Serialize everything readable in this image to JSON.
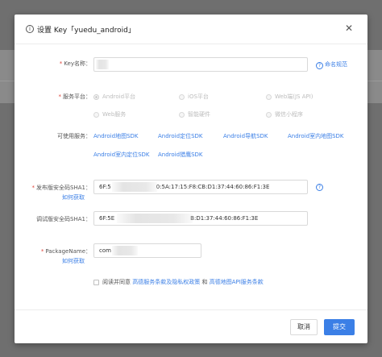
{
  "dialog": {
    "title": "设置 Key「yuedu_android」",
    "close_icon": "close-icon",
    "info_icon": "info-circle-icon"
  },
  "form": {
    "key_name": {
      "label": "Key名称：",
      "value": "",
      "help_link": "命名规范"
    },
    "platform": {
      "label": "服务平台：",
      "options": [
        "Android平台",
        "iOS平台",
        "Web端(JS API)",
        "Web服务",
        "智能硬件",
        "微信小程序"
      ],
      "selected": "Android平台"
    },
    "sdk": {
      "label": "可使用服务：",
      "items": [
        "Android地图SDK",
        "Android定位SDK",
        "Android导航SDK",
        "Android室内地图SDK",
        "Android室内定位SDK",
        "Android猎鹰SDK"
      ]
    },
    "release_sha1": {
      "label": "发布版安全码SHA1：",
      "how": "如何获取",
      "value_start": "6F:5",
      "value_end": "0:5A:17:15:F8:CB:D1:37:44:60:86:F1:3E"
    },
    "debug_sha1": {
      "label": "调试版安全码SHA1：",
      "value_start": "6F:5E",
      "value_end": "B:D1:37:44:60:86:F1:3E"
    },
    "package": {
      "label": "PackageName：",
      "how": "如何获取",
      "value": "com"
    },
    "agreement": {
      "prefix": "阅读并同意",
      "link1": "高德服务条款及隐私权政策",
      "and": "和",
      "link2": "高德地图API服务条款"
    }
  },
  "footer": {
    "cancel_label": "取消",
    "submit_label": "提交"
  },
  "colors": {
    "accent": "#3b7fe6",
    "required": "#e0463c"
  }
}
